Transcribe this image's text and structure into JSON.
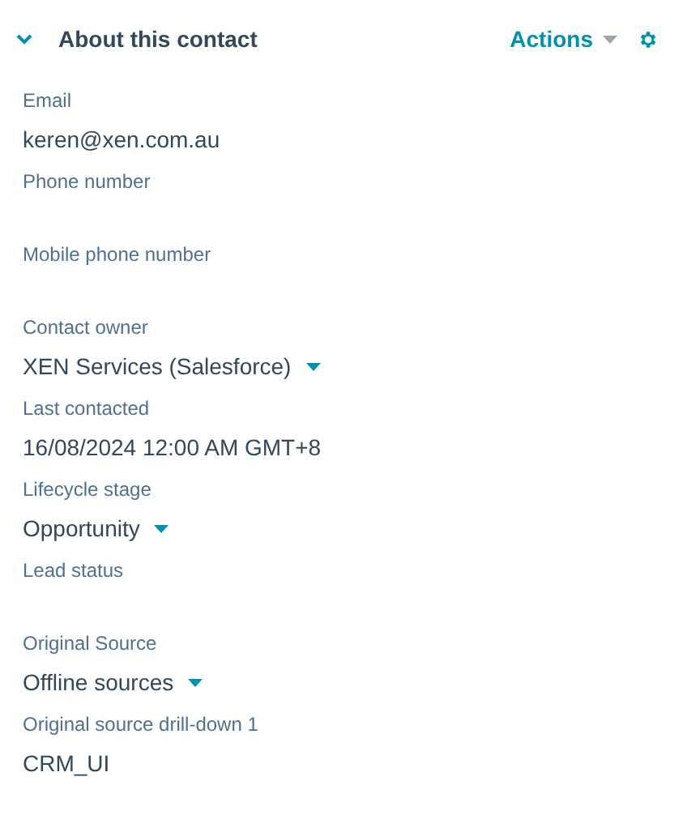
{
  "header": {
    "title": "About this contact",
    "expanded": true,
    "actions_label": "Actions"
  },
  "fields": [
    {
      "label": "Email",
      "kind": "text",
      "value": "keren@xen.com.au"
    },
    {
      "label": "Phone number",
      "kind": "empty"
    },
    {
      "label": "Mobile phone number",
      "kind": "empty"
    },
    {
      "label": "Contact owner",
      "kind": "dropdown",
      "value": "XEN Services (Salesforce)"
    },
    {
      "label": "Last contacted",
      "kind": "text",
      "value": "16/08/2024 12:00 AM GMT+8"
    },
    {
      "label": "Lifecycle stage",
      "kind": "dropdown",
      "value": "Opportunity"
    },
    {
      "label": "Lead status",
      "kind": "empty"
    },
    {
      "label": "Original Source",
      "kind": "dropdown",
      "value": "Offline sources"
    },
    {
      "label": "Original source drill-down 1",
      "kind": "text",
      "value": "CRM_UI"
    }
  ]
}
